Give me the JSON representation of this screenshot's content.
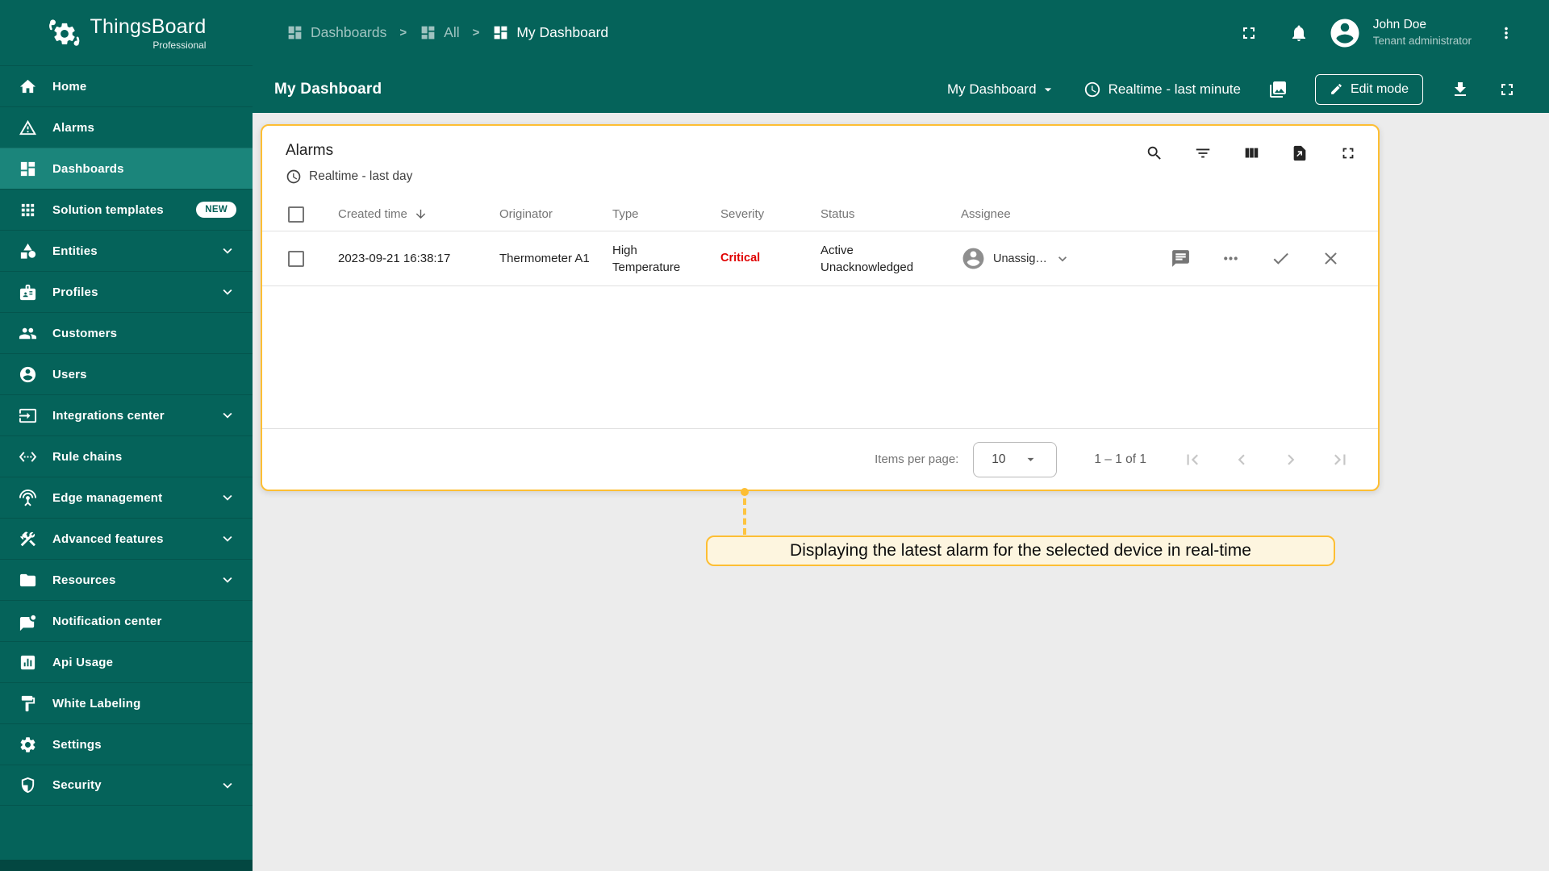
{
  "colors": {
    "primary_teal": "#05635A",
    "selected_item_teal": "#1B857B",
    "accent_amber": "#FDBE33",
    "hint_background": "#FDF5DF",
    "critical_red": "#E00000",
    "content_background": "#ECECEC"
  },
  "brand": {
    "name": "ThingsBoard",
    "edition": "Professional"
  },
  "sidebar": {
    "items": [
      {
        "label": "Home",
        "icon": "home"
      },
      {
        "label": "Alarms",
        "icon": "warning"
      },
      {
        "label": "Dashboards",
        "icon": "dashboard",
        "selected": true
      },
      {
        "label": "Solution templates",
        "icon": "apps",
        "badge": "NEW"
      },
      {
        "label": "Entities",
        "icon": "category",
        "expandable": true
      },
      {
        "label": "Profiles",
        "icon": "badge",
        "expandable": true
      },
      {
        "label": "Customers",
        "icon": "people"
      },
      {
        "label": "Users",
        "icon": "account"
      },
      {
        "label": "Integrations center",
        "icon": "input",
        "expandable": true
      },
      {
        "label": "Rule chains",
        "icon": "ethernet"
      },
      {
        "label": "Edge management",
        "icon": "antenna",
        "expandable": true
      },
      {
        "label": "Advanced features",
        "icon": "construction",
        "expandable": true
      },
      {
        "label": "Resources",
        "icon": "folder",
        "expandable": true
      },
      {
        "label": "Notification center",
        "icon": "chat"
      },
      {
        "label": "Api Usage",
        "icon": "poll"
      },
      {
        "label": "White Labeling",
        "icon": "paint"
      },
      {
        "label": "Settings",
        "icon": "gear"
      },
      {
        "label": "Security",
        "icon": "shield",
        "expandable": true
      }
    ]
  },
  "topbar": {
    "breadcrumbs": [
      {
        "label": "Dashboards"
      },
      {
        "label": "All"
      },
      {
        "label": "My Dashboard"
      }
    ],
    "separator": ">",
    "user": {
      "name": "John Doe",
      "role": "Tenant administrator"
    }
  },
  "toolbar": {
    "title": "My Dashboard",
    "dashboard_select": "My Dashboard",
    "timewindow": "Realtime - last minute",
    "edit_button": "Edit mode"
  },
  "widget": {
    "title": "Alarms",
    "timewindow": "Realtime - last day",
    "table": {
      "columns": [
        "Created time",
        "Originator",
        "Type",
        "Severity",
        "Status",
        "Assignee"
      ],
      "rows": [
        {
          "created_time": "2023-09-21 16:38:17",
          "originator": "Thermometer A1",
          "type": "High Temperature",
          "severity": "Critical",
          "status": "Active Unacknowledged",
          "assignee": "Unassig…"
        }
      ]
    },
    "footer": {
      "items_per_page_label": "Items per page:",
      "items_per_page": "10",
      "range_label": "1 – 1 of 1"
    }
  },
  "tooltip": {
    "text": "Displaying the latest alarm for the selected device in real-time"
  }
}
